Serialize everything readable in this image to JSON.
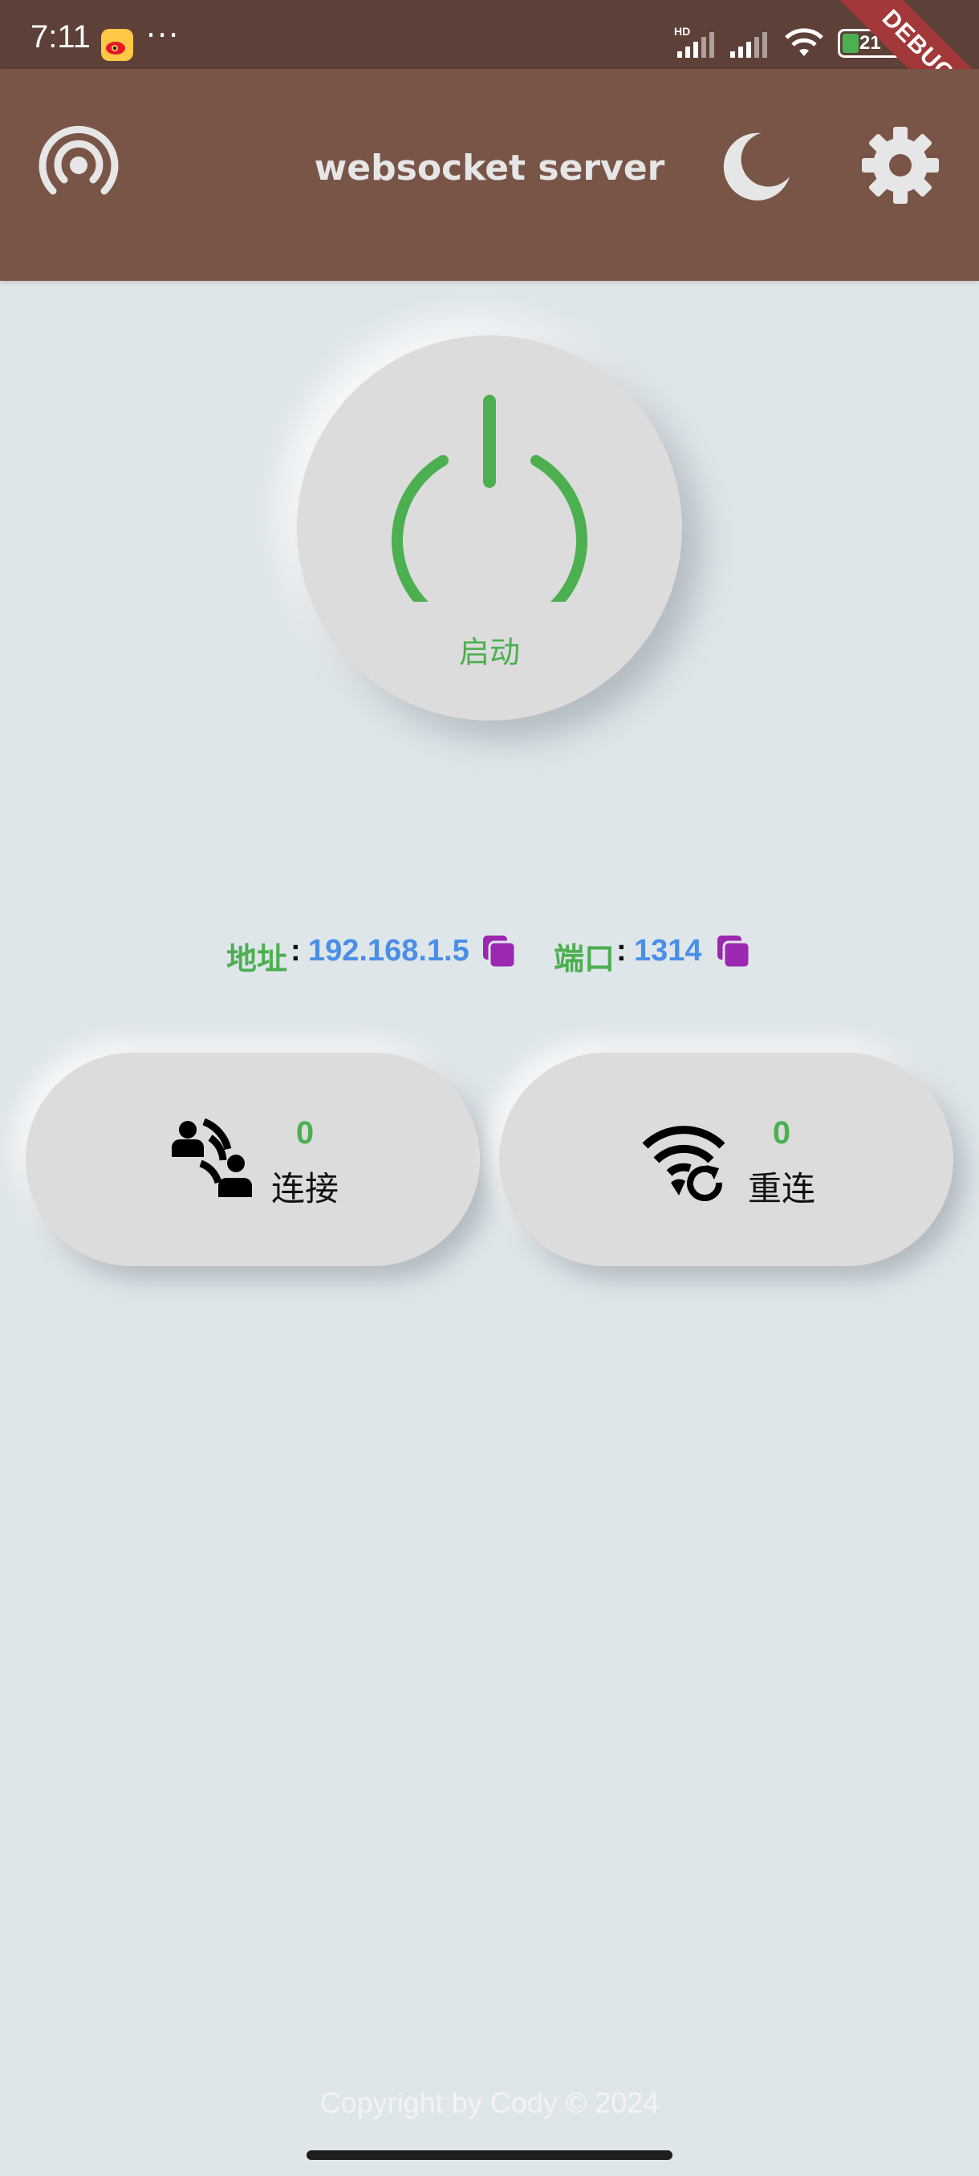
{
  "status_bar": {
    "time": "7:11",
    "overflow": "···",
    "battery_level": "21",
    "signal_badge": "HD",
    "debug_label": "DEBUG"
  },
  "app_bar": {
    "title": "websocket server",
    "left_icon": "broadcast-icon",
    "theme_icon": "moon-icon",
    "settings_icon": "gear-icon"
  },
  "power": {
    "label": "启动",
    "color": "#4CAF50"
  },
  "info": {
    "address_label": "地址",
    "address_value": "192.168.1.5",
    "port_label": "端口",
    "port_value": "1314",
    "separator": ":",
    "copy_icon": "copy-icon"
  },
  "cards": {
    "connect": {
      "count": "0",
      "label": "连接",
      "icon": "person-connect-icon"
    },
    "reconnect": {
      "count": "0",
      "label": "重连",
      "icon": "wifi-reconnect-icon"
    }
  },
  "footer": {
    "copyright": "Copyright by Cody © 2024"
  },
  "colors": {
    "status_bar": "#5D4037",
    "app_bar": "#795548",
    "background": "#DFE6EA",
    "accent_green": "#4CAF50",
    "value_blue": "#4A8FE7",
    "copy_purple": "#9C27B0"
  }
}
